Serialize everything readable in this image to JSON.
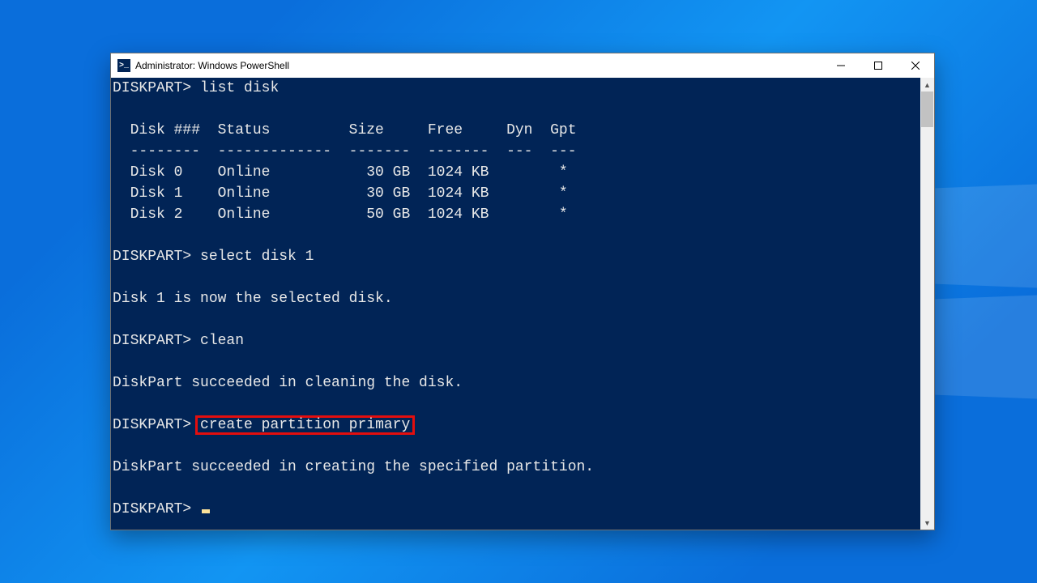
{
  "window": {
    "title": "Administrator: Windows PowerShell",
    "icon_glyph": ">_"
  },
  "console": {
    "prompt": "DISKPART>",
    "lines": {
      "cmd_list": "list disk",
      "header": "  Disk ###  Status         Size     Free     Dyn  Gpt",
      "divider": "  --------  -------------  -------  -------  ---  ---",
      "row0": "  Disk 0    Online           30 GB  1024 KB        *",
      "row1": "  Disk 1    Online           30 GB  1024 KB        *",
      "row2": "  Disk 2    Online           50 GB  1024 KB        *",
      "cmd_select": "select disk 1",
      "msg_selected": "Disk 1 is now the selected disk.",
      "cmd_clean": "clean",
      "msg_cleaned": "DiskPart succeeded in cleaning the disk.",
      "cmd_create": "create partition primary",
      "msg_created": "DiskPart succeeded in creating the specified partition."
    }
  },
  "disks": [
    {
      "id": "Disk 0",
      "status": "Online",
      "size": "30 GB",
      "free": "1024 KB",
      "dyn": "",
      "gpt": "*"
    },
    {
      "id": "Disk 1",
      "status": "Online",
      "size": "30 GB",
      "free": "1024 KB",
      "dyn": "",
      "gpt": "*"
    },
    {
      "id": "Disk 2",
      "status": "Online",
      "size": "50 GB",
      "free": "1024 KB",
      "dyn": "",
      "gpt": "*"
    }
  ]
}
